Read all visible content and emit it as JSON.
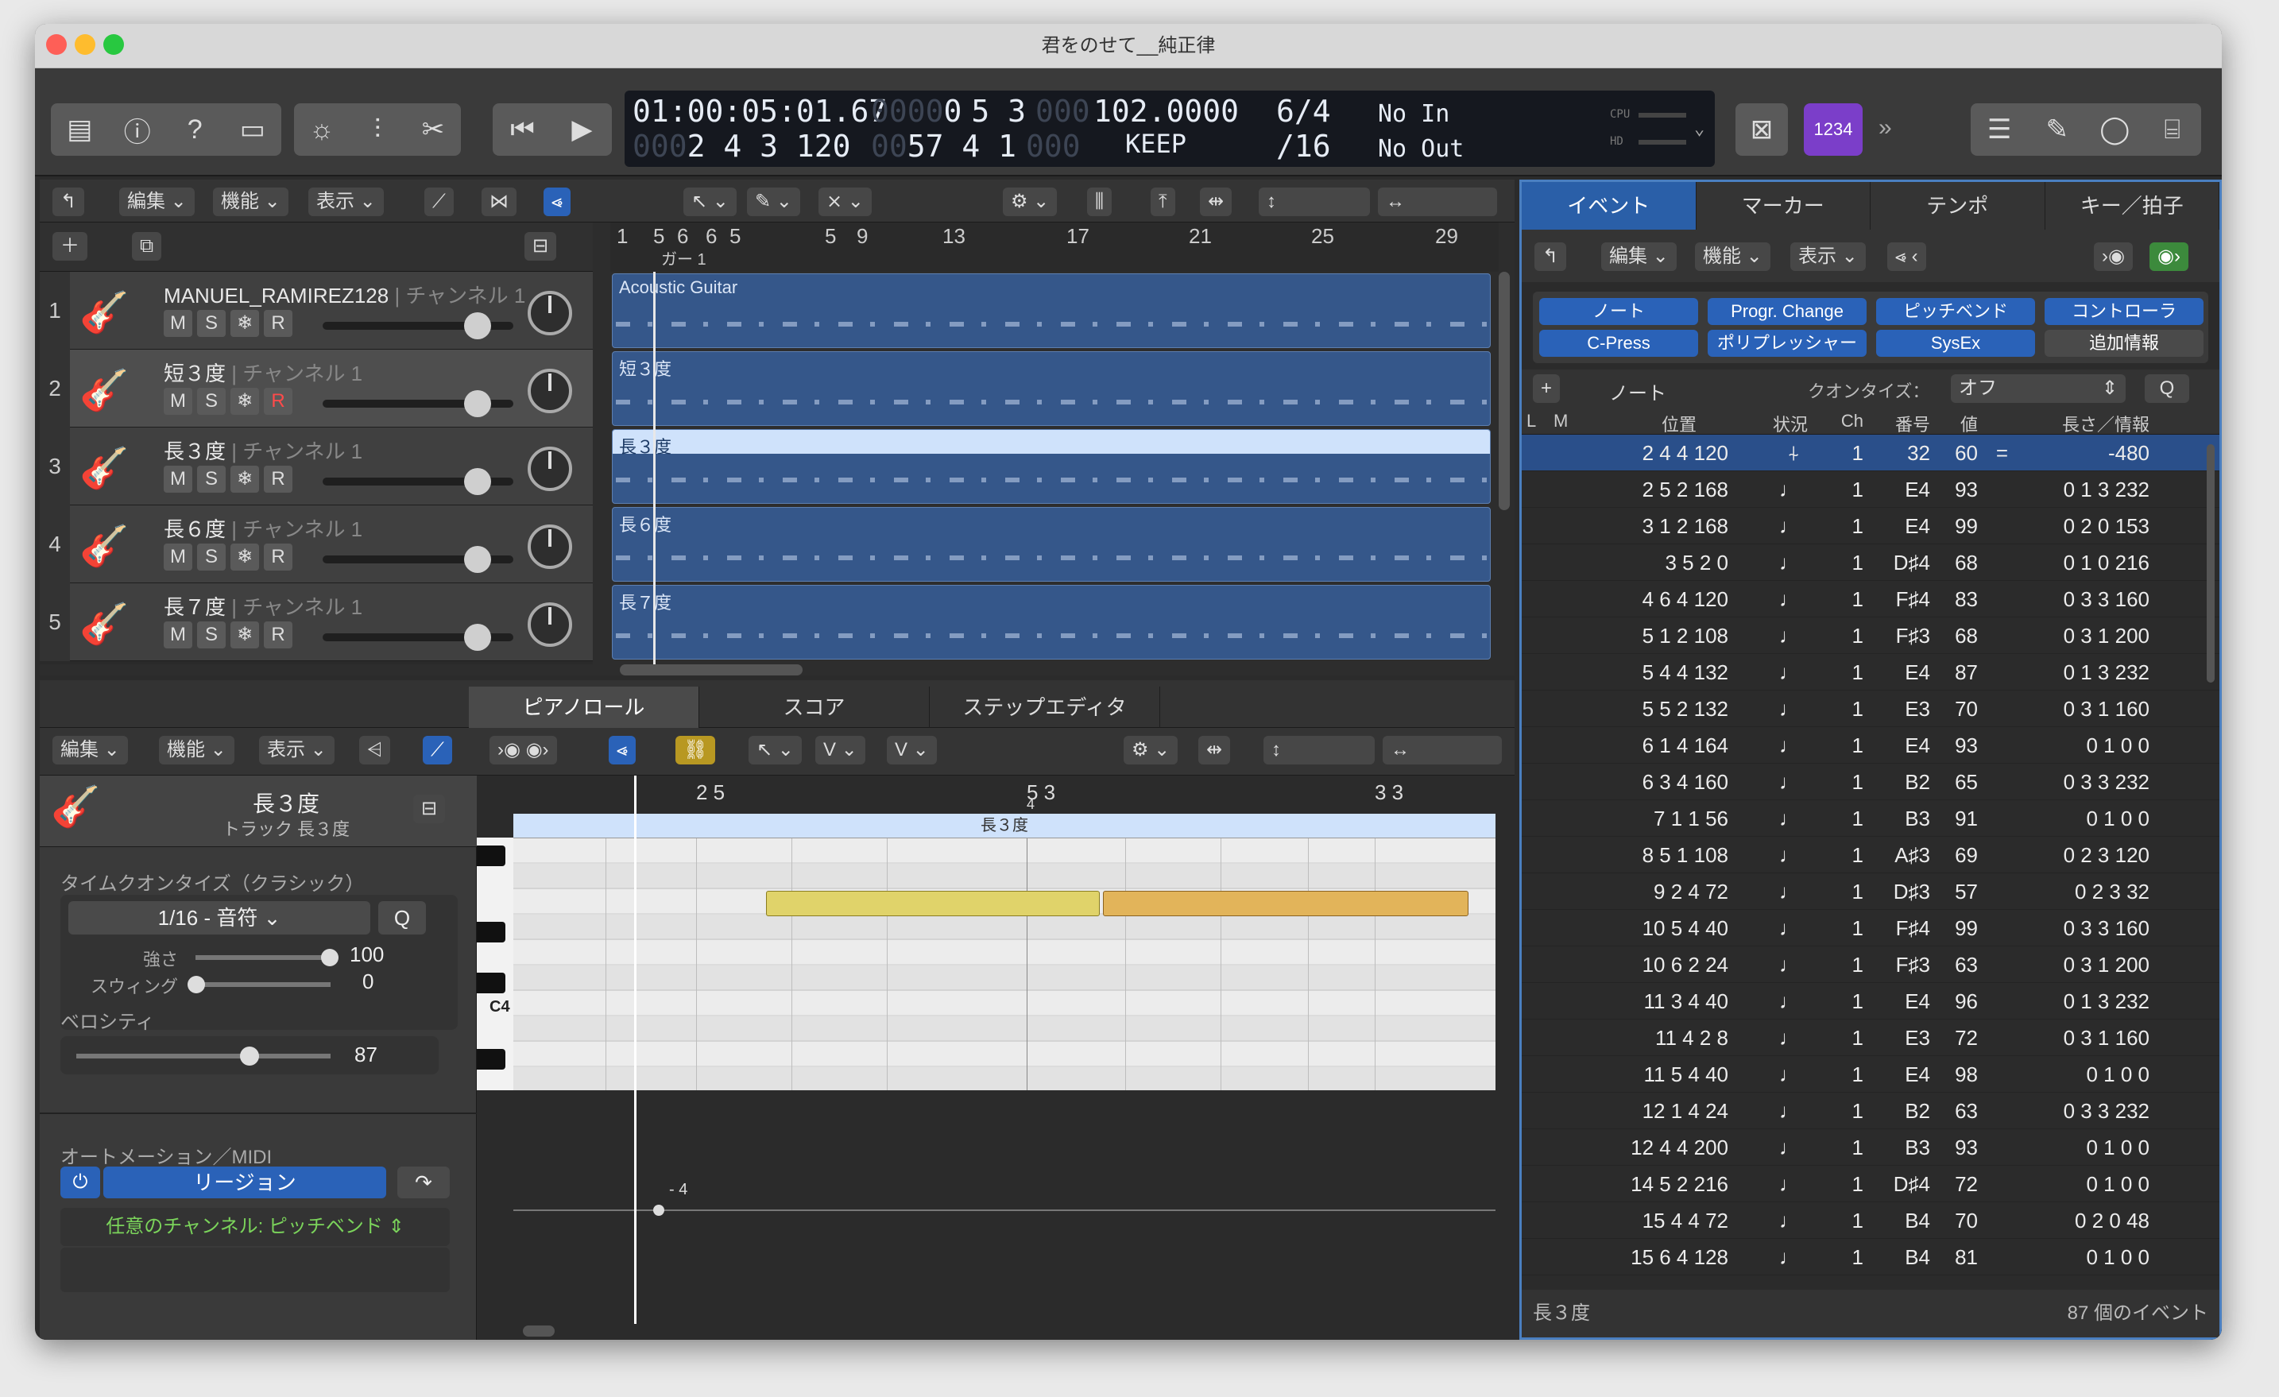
{
  "window": {
    "title": "君をのせて__純正律"
  },
  "lcd": {
    "time": "01:00:05:01.67",
    "time_dim": "0000",
    "bars_dim": "0",
    "bars": "5 3",
    "bars_dim2": "000",
    "pos": "2 4 3 120",
    "pos_dim": "000",
    "pos2_dim": "00",
    "pos2": "57 4 1",
    "pos2_dim2": "000",
    "tempo": "102.0000",
    "tempo_mode": "KEEP",
    "sig": "6/4",
    "div": "/16",
    "midi_in": "No In",
    "midi_out": "No Out",
    "cpu": "CPU",
    "hd": "HD"
  },
  "toolbar": {
    "count_in": "1234"
  },
  "tracks_bar": {
    "edit": "編集",
    "func": "機能",
    "view": "表示"
  },
  "ruler": {
    "marks": [
      "1",
      "5",
      "6",
      "6",
      "5",
      "5",
      "9",
      "13",
      "17",
      "21",
      "25",
      "29"
    ],
    "marker": "ガー 1"
  },
  "tracks": [
    {
      "num": "1",
      "name": "MANUEL_RAMIREZ128",
      "channel": "| チャンネル 1",
      "region": "Acoustic Guitar"
    },
    {
      "num": "2",
      "name": "短３度",
      "channel": "| チャンネル 1",
      "region": "短３度"
    },
    {
      "num": "3",
      "name": "長３度",
      "channel": "| チャンネル 1",
      "region": "長３度"
    },
    {
      "num": "4",
      "name": "長６度",
      "channel": "| チャンネル 1",
      "region": "長６度"
    },
    {
      "num": "5",
      "name": "長７度",
      "channel": "| チャンネル 1",
      "region": "長７度"
    }
  ],
  "msr": {
    "m": "M",
    "s": "S",
    "r": "R"
  },
  "editor": {
    "tabs": [
      "ピアノロール",
      "スコア",
      "ステップエディタ"
    ],
    "edit": "編集",
    "func": "機能",
    "view": "表示"
  },
  "inspector": {
    "region_name": "長３度",
    "track_label": "トラック 長３度",
    "quantize_title": "タイムクオンタイズ（クラシック）",
    "quantize": "1/16 - 音符",
    "q": "Q",
    "strength_label": "強さ",
    "strength": "100",
    "swing_label": "スウィング",
    "swing": "0",
    "velocity_label": "ベロシティ",
    "velocity": "87",
    "automation_title": "オートメーション／MIDI",
    "region_btn": "リージョン",
    "channel_select": "任意のチャンネル: ピッチベンド"
  },
  "pianoroll": {
    "ruler": [
      "2 5",
      "5 3",
      "4",
      "3 3"
    ],
    "region_label": "長３度",
    "c4": "C4",
    "pb_value": "- 4"
  },
  "eventlist": {
    "tabs": [
      "イベント",
      "マーカー",
      "テンポ",
      "キー／拍子"
    ],
    "edit": "編集",
    "func": "機能",
    "view": "表示",
    "filters": [
      "ノート",
      "Progr. Change",
      "ピッチベンド",
      "コントローラ",
      "C-Press",
      "ポリプレッシャー",
      "SysEx",
      "追加情報"
    ],
    "add": "+",
    "create_type": "ノート",
    "quantize_label": "クオンタイズ：",
    "quantize_value": "オフ",
    "q": "Q",
    "headers": {
      "l": "L",
      "m": "M",
      "pos": "位置",
      "status": "状況",
      "ch": "Ch",
      "num": "番号",
      "val": "値",
      "len": "長さ／情報"
    },
    "rows": [
      {
        "pos": "2 4 4 120",
        "status": "⍭",
        "ch": "1",
        "num": "32",
        "val": "60",
        "eq": "=",
        "len": "-480"
      },
      {
        "pos": "2 5 2 168",
        "status": "♩",
        "ch": "1",
        "num": "E4",
        "val": "93",
        "eq": "",
        "len": "0 1 3 232"
      },
      {
        "pos": "3 1 2 168",
        "status": "♩",
        "ch": "1",
        "num": "E4",
        "val": "99",
        "eq": "",
        "len": "0 2 0 153"
      },
      {
        "pos": "3 5 2 0",
        "status": "♩",
        "ch": "1",
        "num": "D♯4",
        "val": "68",
        "eq": "",
        "len": "0 1 0 216"
      },
      {
        "pos": "4 6 4 120",
        "status": "♩",
        "ch": "1",
        "num": "F♯4",
        "val": "83",
        "eq": "",
        "len": "0 3 3 160"
      },
      {
        "pos": "5 1 2 108",
        "status": "♩",
        "ch": "1",
        "num": "F♯3",
        "val": "68",
        "eq": "",
        "len": "0 3 1 200"
      },
      {
        "pos": "5 4 4 132",
        "status": "♩",
        "ch": "1",
        "num": "E4",
        "val": "87",
        "eq": "",
        "len": "0 1 3 232"
      },
      {
        "pos": "5 5 2 132",
        "status": "♩",
        "ch": "1",
        "num": "E3",
        "val": "70",
        "eq": "",
        "len": "0 3 1 160"
      },
      {
        "pos": "6 1 4 164",
        "status": "♩",
        "ch": "1",
        "num": "E4",
        "val": "93",
        "eq": "",
        "len": "0 1 0 0"
      },
      {
        "pos": "6 3 4 160",
        "status": "♩",
        "ch": "1",
        "num": "B2",
        "val": "65",
        "eq": "",
        "len": "0 3 3 232"
      },
      {
        "pos": "7 1 1 56",
        "status": "♩",
        "ch": "1",
        "num": "B3",
        "val": "91",
        "eq": "",
        "len": "0 1 0 0"
      },
      {
        "pos": "8 5 1 108",
        "status": "♩",
        "ch": "1",
        "num": "A♯3",
        "val": "69",
        "eq": "",
        "len": "0 2 3 120"
      },
      {
        "pos": "9 2 4 72",
        "status": "♩",
        "ch": "1",
        "num": "D♯3",
        "val": "57",
        "eq": "",
        "len": "0 2 3 32"
      },
      {
        "pos": "10 5 4 40",
        "status": "♩",
        "ch": "1",
        "num": "F♯4",
        "val": "99",
        "eq": "",
        "len": "0 3 3 160"
      },
      {
        "pos": "10 6 2 24",
        "status": "♩",
        "ch": "1",
        "num": "F♯3",
        "val": "63",
        "eq": "",
        "len": "0 3 1 200"
      },
      {
        "pos": "11 3 4 40",
        "status": "♩",
        "ch": "1",
        "num": "E4",
        "val": "96",
        "eq": "",
        "len": "0 1 3 232"
      },
      {
        "pos": "11 4 2 8",
        "status": "♩",
        "ch": "1",
        "num": "E3",
        "val": "72",
        "eq": "",
        "len": "0 3 1 160"
      },
      {
        "pos": "11 5 4 40",
        "status": "♩",
        "ch": "1",
        "num": "E4",
        "val": "98",
        "eq": "",
        "len": "0 1 0 0"
      },
      {
        "pos": "12 1 4 24",
        "status": "♩",
        "ch": "1",
        "num": "B2",
        "val": "63",
        "eq": "",
        "len": "0 3 3 232"
      },
      {
        "pos": "12 4 4 200",
        "status": "♩",
        "ch": "1",
        "num": "B3",
        "val": "93",
        "eq": "",
        "len": "0 1 0 0"
      },
      {
        "pos": "14 5 2 216",
        "status": "♩",
        "ch": "1",
        "num": "D♯4",
        "val": "72",
        "eq": "",
        "len": "0 1 0 0"
      },
      {
        "pos": "15 4 4 72",
        "status": "♩",
        "ch": "1",
        "num": "B4",
        "val": "70",
        "eq": "",
        "len": "0 2 0 48"
      },
      {
        "pos": "15 6 4 128",
        "status": "♩",
        "ch": "1",
        "num": "B4",
        "val": "81",
        "eq": "",
        "len": "0 1 0 0"
      }
    ],
    "footer_left": "長３度",
    "footer_right": "87 個のイベント"
  }
}
